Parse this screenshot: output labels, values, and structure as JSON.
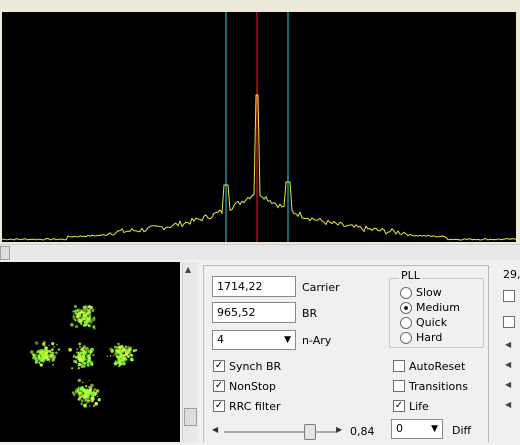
{
  "spectrum": {
    "colors": {
      "background": "#000000",
      "trace": "#e8e840",
      "marker_center": "#ff2020",
      "marker_bounds": "#30d0e0"
    }
  },
  "controls": {
    "carrier_value": "1714,22",
    "carrier_label": "Carrier",
    "br_value": "965,52",
    "br_label": "BR",
    "nary_value": "4",
    "nary_label": "n-Ary",
    "synch_br": {
      "label": "Synch BR",
      "checked": true
    },
    "nonstop": {
      "label": "NonStop",
      "checked": true
    },
    "rrc_filter": {
      "label": "RRC filter",
      "checked": true
    },
    "slider_value": "0,84",
    "slider_position": 0.8,
    "pll": {
      "title": "PLL",
      "options": [
        {
          "label": "Slow",
          "selected": false
        },
        {
          "label": "Medium",
          "selected": true
        },
        {
          "label": "Quick",
          "selected": false
        },
        {
          "label": "Hard",
          "selected": false
        }
      ]
    },
    "autoreset": {
      "label": "AutoReset",
      "checked": false
    },
    "transitions": {
      "label": "Transitions",
      "checked": false
    },
    "life": {
      "label": "Life",
      "checked": true
    },
    "diff_value": "0",
    "diff_label": "Diff"
  },
  "right_edge": {
    "value": "29,"
  },
  "constellation": {
    "colors": {
      "points": "#8cff3a",
      "background": "#000000"
    }
  }
}
